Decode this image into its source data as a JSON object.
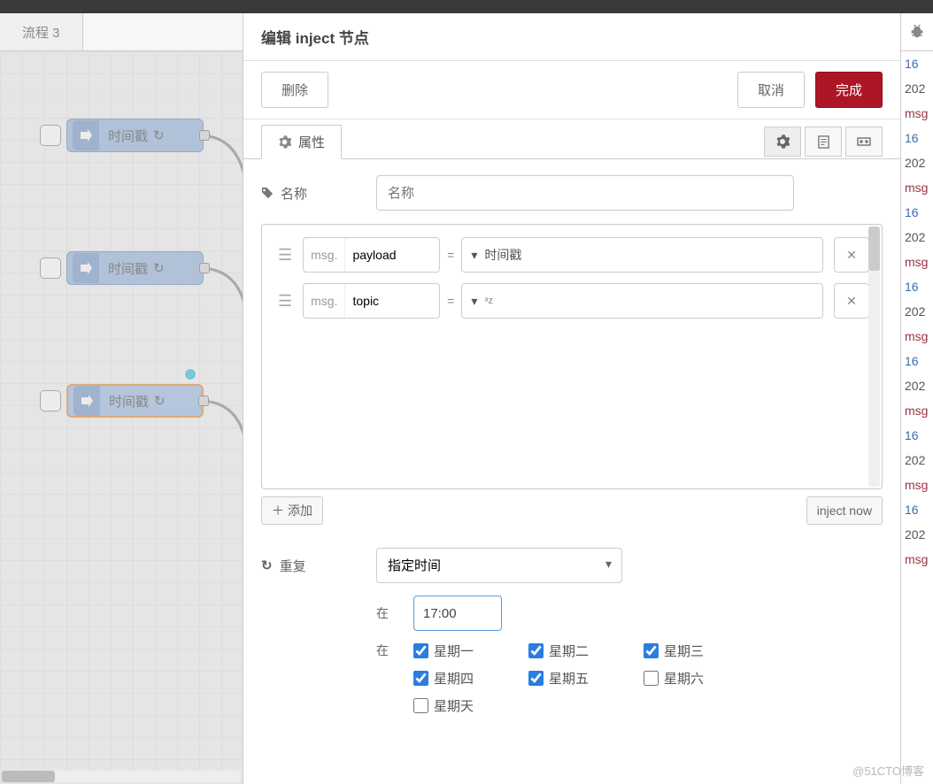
{
  "tab": {
    "title": "流程 3"
  },
  "nodes": {
    "n1": "时间戳",
    "n2": "时间戳",
    "n3": "时间戳"
  },
  "editor": {
    "title": "编辑 inject 节点",
    "delete": "删除",
    "cancel": "取消",
    "done": "完成",
    "tabs": {
      "props": "属性"
    },
    "name_label": "名称",
    "name_placeholder": "名称",
    "props": [
      {
        "prefix": "msg.",
        "field": "payload",
        "type_label": "时间戳"
      },
      {
        "prefix": "msg.",
        "field": "topic",
        "type_label": "ᵃz"
      }
    ],
    "add": "添加",
    "inject_now": "inject now",
    "repeat_label": "重复",
    "repeat_option": "指定时间",
    "at_label": "在",
    "time_value": "17:00",
    "days": [
      {
        "label": "星期一",
        "checked": true
      },
      {
        "label": "星期二",
        "checked": true
      },
      {
        "label": "星期三",
        "checked": true
      },
      {
        "label": "星期四",
        "checked": true
      },
      {
        "label": "星期五",
        "checked": true
      },
      {
        "label": "星期六",
        "checked": false
      },
      {
        "label": "星期天",
        "checked": false
      }
    ]
  },
  "sidebar": {
    "items": [
      "16",
      "202",
      "msg",
      "16",
      "202",
      "msg",
      "16",
      "202",
      "msg",
      "16",
      "202",
      "msg",
      "16",
      "202",
      "msg",
      "16",
      "202",
      "msg",
      "16",
      "202",
      "msg"
    ]
  },
  "watermark": "@51CTO博客"
}
